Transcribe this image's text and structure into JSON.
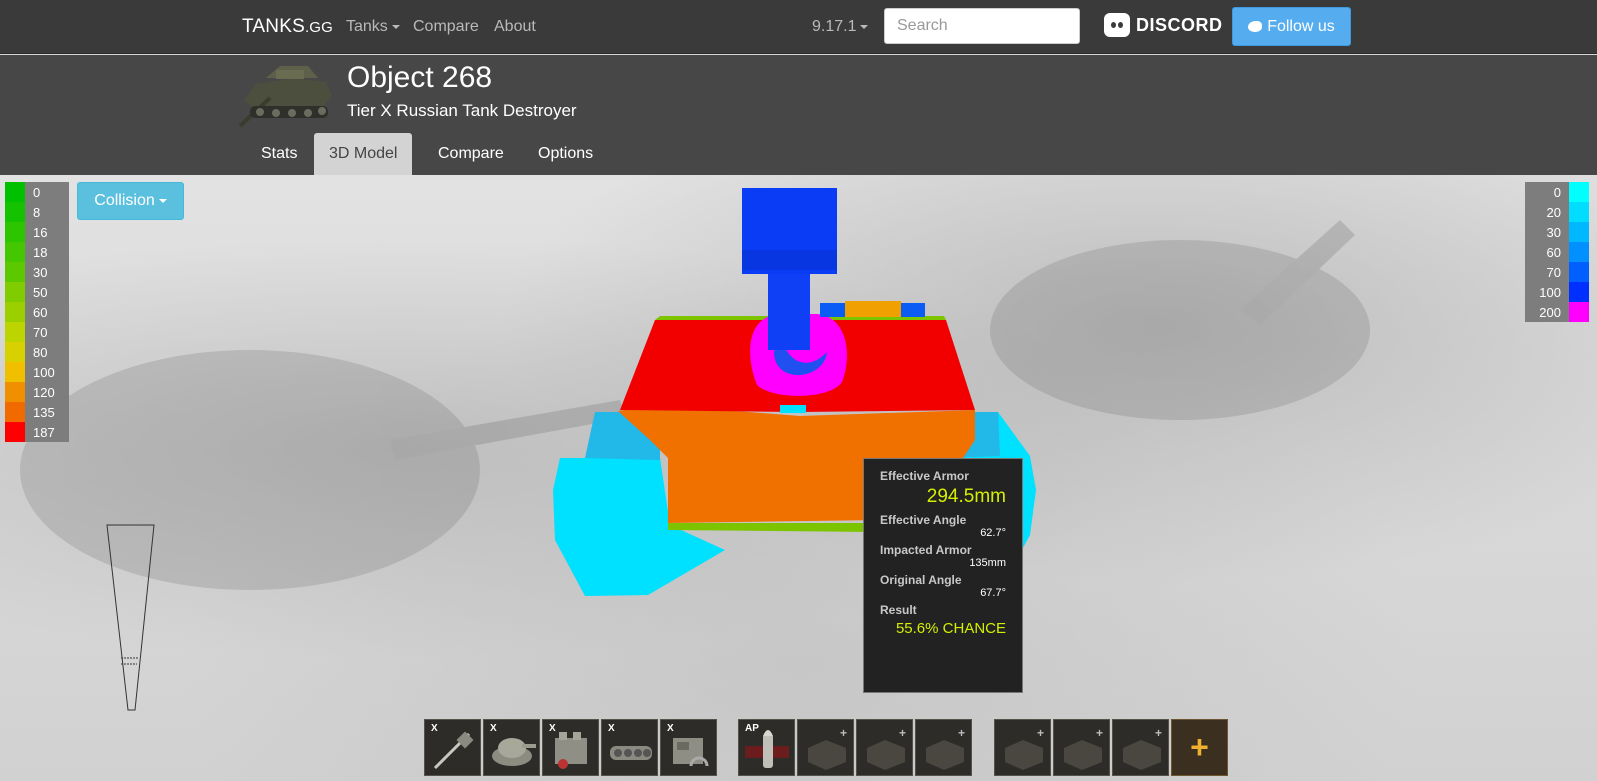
{
  "nav": {
    "brand_main": "TANKS",
    "brand_suffix": ".GG",
    "tanks_label": "Tanks",
    "compare_label": "Compare",
    "about_label": "About",
    "version_label": "9.17.1",
    "search_placeholder": "Search",
    "discord_label": "DISCORD",
    "follow_label": "Follow us"
  },
  "tank": {
    "name": "Object 268",
    "subtitle": "Tier X Russian Tank Destroyer"
  },
  "tabs": [
    {
      "label": "Stats"
    },
    {
      "label": "3D Model"
    },
    {
      "label": "Compare"
    },
    {
      "label": "Options"
    }
  ],
  "active_tab": "3D Model",
  "collision_label": "Collision",
  "legend_left": [
    {
      "value": "0",
      "color": "#00c000"
    },
    {
      "value": "8",
      "color": "#14c200"
    },
    {
      "value": "16",
      "color": "#2cc500"
    },
    {
      "value": "18",
      "color": "#44c600"
    },
    {
      "value": "30",
      "color": "#5cc800"
    },
    {
      "value": "50",
      "color": "#80cc00"
    },
    {
      "value": "60",
      "color": "#9ccf00"
    },
    {
      "value": "70",
      "color": "#bcd400"
    },
    {
      "value": "80",
      "color": "#d8d000"
    },
    {
      "value": "100",
      "color": "#f0c000"
    },
    {
      "value": "120",
      "color": "#f09000"
    },
    {
      "value": "135",
      "color": "#f06a00"
    },
    {
      "value": "187",
      "color": "#ff0000"
    }
  ],
  "legend_right": [
    {
      "value": "0",
      "color": "#00ffff"
    },
    {
      "value": "20",
      "color": "#00ddff"
    },
    {
      "value": "30",
      "color": "#00b8ff"
    },
    {
      "value": "60",
      "color": "#0090ff"
    },
    {
      "value": "70",
      "color": "#0060ff"
    },
    {
      "value": "100",
      "color": "#0030ff"
    },
    {
      "value": "200",
      "color": "#ff00ff"
    }
  ],
  "tooltip": {
    "effective_armor_label": "Effective Armor",
    "effective_armor_value": "294.5mm",
    "effective_angle_label": "Effective Angle",
    "effective_angle_value": "62.7°",
    "impacted_armor_label": "Impacted Armor",
    "impacted_armor_value": "135mm",
    "original_angle_label": "Original Angle",
    "original_angle_value": "67.7°",
    "result_label": "Result",
    "result_value": "55.6% CHANCE"
  },
  "modules": [
    {
      "tag": "X",
      "icon": "gun-icon"
    },
    {
      "tag": "X",
      "icon": "turret-icon"
    },
    {
      "tag": "X",
      "icon": "engine-icon"
    },
    {
      "tag": "X",
      "icon": "suspension-icon"
    },
    {
      "tag": "X",
      "icon": "radio-icon"
    }
  ],
  "ammo": [
    {
      "tag": "AP",
      "icon": "shell-icon"
    }
  ],
  "equipment_slots": 3,
  "consumable_slots": 3,
  "add_label": "+",
  "slot_plus": "+"
}
